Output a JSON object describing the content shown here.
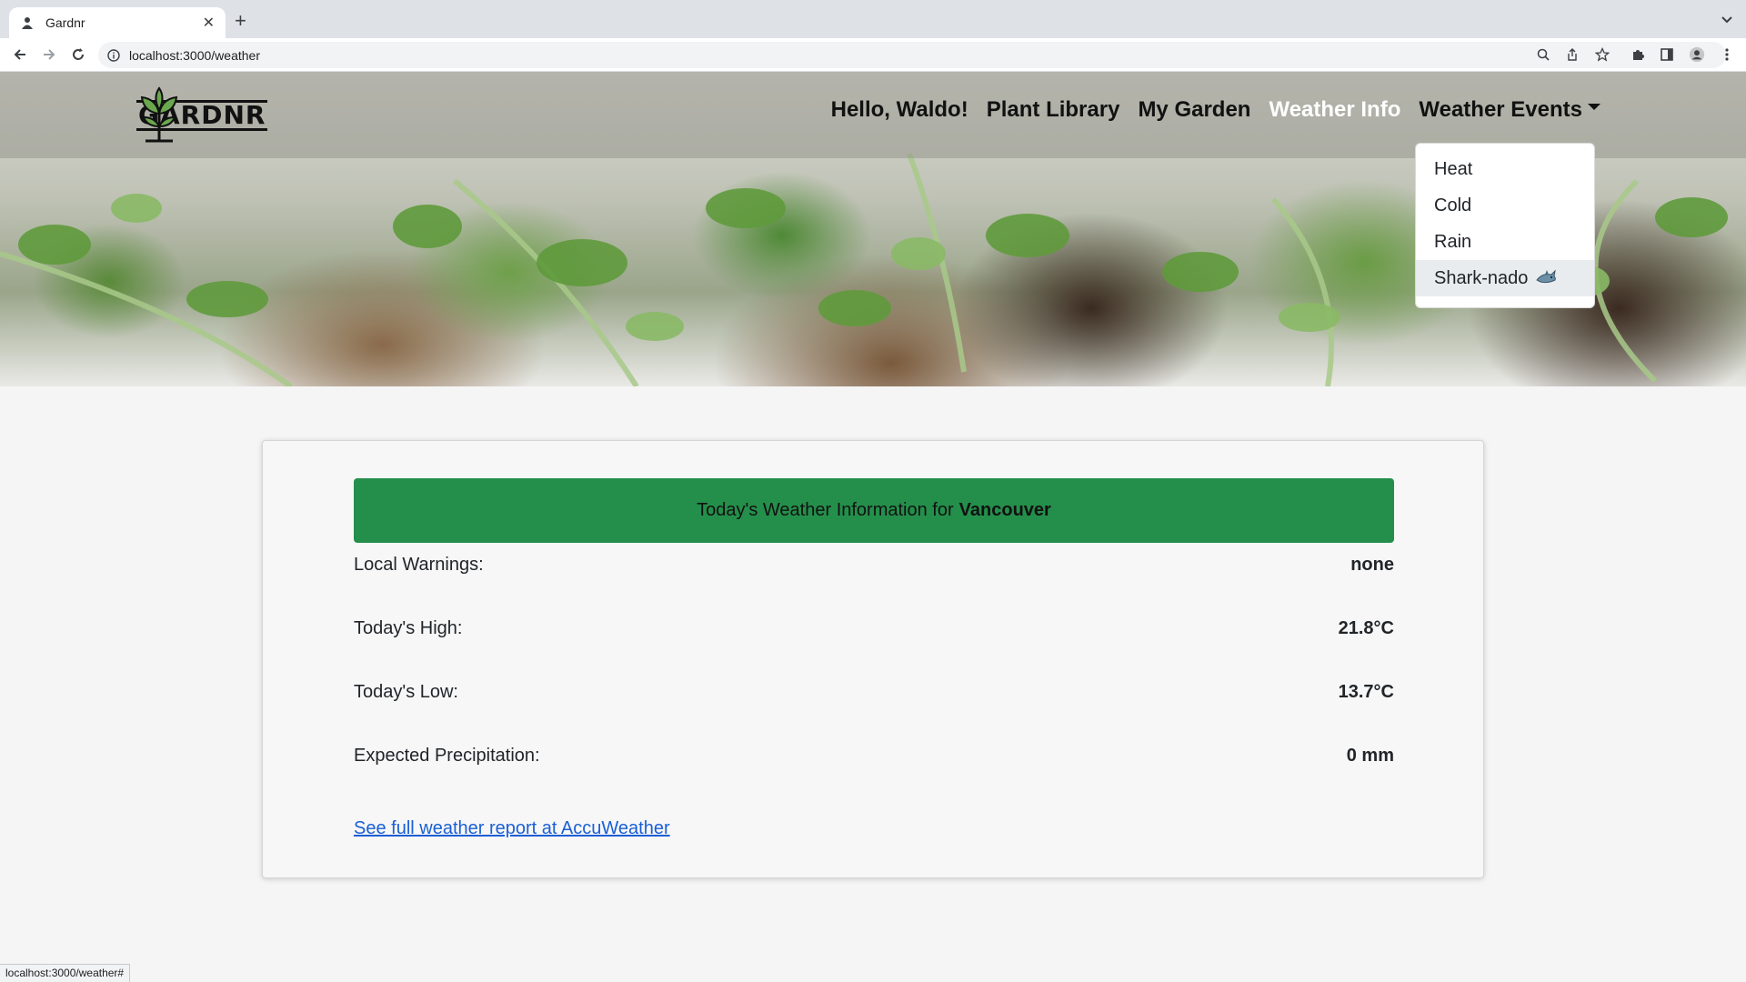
{
  "browser": {
    "tab_title": "Gardnr",
    "url": "localhost:3000/weather",
    "status_url": "localhost:3000/weather#"
  },
  "navbar": {
    "logo_text": "GARDNR",
    "links": {
      "greeting": "Hello, Waldo!",
      "plant_library": "Plant Library",
      "my_garden": "My Garden",
      "weather_info": "Weather Info",
      "weather_events": "Weather Events"
    },
    "active_link_color": "#ffffff"
  },
  "dropdown": {
    "items": [
      "Heat",
      "Cold",
      "Rain",
      "Shark-nado"
    ],
    "highlighted_item": "Shark-nado",
    "shark_icon": "shark-emoji-icon"
  },
  "weather": {
    "header_prefix": "Today's Weather Information for",
    "city": "Vancouver",
    "header_color": "#248f4b",
    "rows": [
      {
        "label": "Local Warnings:",
        "value": "none"
      },
      {
        "label": "Today's High:",
        "value": "21.8°C"
      },
      {
        "label": "Today's Low:",
        "value": "13.7°C"
      },
      {
        "label": "Expected Precipitation:",
        "value": "0 mm"
      }
    ],
    "link_text": "See full weather report at AccuWeather"
  }
}
